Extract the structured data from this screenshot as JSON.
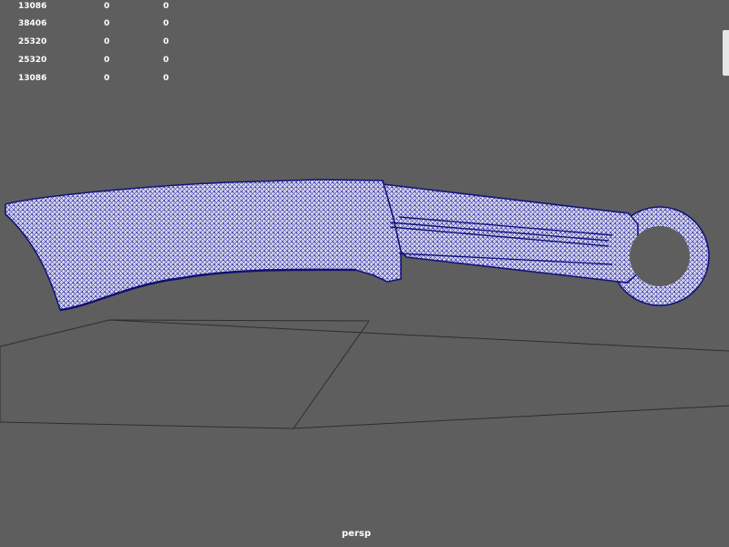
{
  "viewport": {
    "camera": "persp",
    "background_color": "#5e5e5e",
    "wireframe_color": "#1a1a8c"
  },
  "hud": {
    "rows": [
      {
        "value": "13086",
        "a": "0",
        "b": "0"
      },
      {
        "value": "38406",
        "a": "0",
        "b": "0"
      },
      {
        "value": "25320",
        "a": "0",
        "b": "0"
      },
      {
        "value": "25320",
        "a": "0",
        "b": "0"
      },
      {
        "value": "13086",
        "a": "0",
        "b": "0"
      }
    ]
  },
  "model": {
    "icon": "knife-wireframe-mesh"
  }
}
